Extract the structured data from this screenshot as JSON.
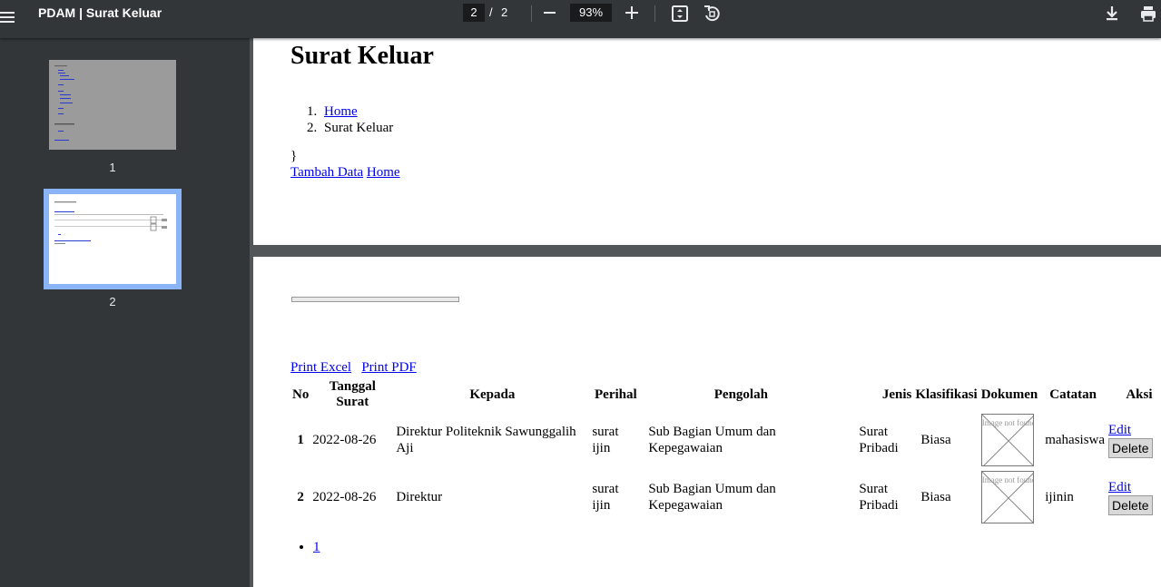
{
  "toolbar": {
    "title": "PDAM | Surat Keluar",
    "current_page": "2",
    "separator": "/",
    "total_pages": "2",
    "zoom": "93%"
  },
  "sidebar": {
    "thumbnails": [
      {
        "label": "1",
        "selected": false
      },
      {
        "label": "2",
        "selected": true
      }
    ]
  },
  "page1": {
    "heading": "Surat Keluar",
    "breadcrumb": [
      {
        "num": "1.",
        "label": "Home",
        "link": true
      },
      {
        "num": "2.",
        "label": "Surat Keluar",
        "link": false
      }
    ],
    "brace": "}",
    "add_link": "Tambah Data",
    "home_link": "Home"
  },
  "page2": {
    "print_excel": "Print Excel",
    "print_pdf": "Print PDF",
    "table": {
      "headers": [
        "No",
        "Tanggal Surat",
        "Kepada",
        "Perihal",
        "Pengolah",
        "Jenis",
        "Klasifikasi",
        "Dokumen",
        "Catatan",
        "Aksi"
      ],
      "rows": [
        {
          "no": "1",
          "tanggal": "2022-08-26",
          "kepada": "Direktur Politeknik Sawunggalih Aji",
          "perihal": "surat ijin",
          "pengolah": "Sub Bagian Umum dan Kepegawaian",
          "jenis": "Surat Pribadi",
          "klasifikasi": "Biasa",
          "dokumen_alt": "Image not found or type unknown",
          "catatan": "mahasiswa",
          "edit": "Edit",
          "delete": "Delete"
        },
        {
          "no": "2",
          "tanggal": "2022-08-26",
          "kepada": "Direktur",
          "perihal": "surat ijin",
          "pengolah": "Sub Bagian Umum dan Kepegawaian",
          "jenis": "Surat Pribadi",
          "klasifikasi": "Biasa",
          "dokumen_alt": "Image not found or type unknown",
          "catatan": "ijinin",
          "edit": "Edit",
          "delete": "Delete"
        }
      ]
    },
    "pagination": [
      "1"
    ]
  },
  "colors": {
    "toolbar_bg": "#323639",
    "viewer_bg": "#525659",
    "link": "#0000ee",
    "thumb_selected": "#8ab4f8"
  }
}
